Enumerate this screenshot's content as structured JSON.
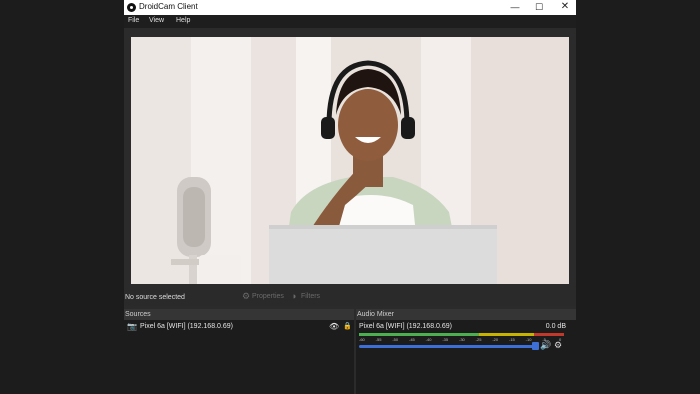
{
  "window": {
    "title": "DroidCam Client"
  },
  "menu": {
    "items": [
      "File",
      "View",
      "Help"
    ]
  },
  "toolbar": {
    "no_source": "No source selected",
    "properties": "Properties",
    "filters": "Filters"
  },
  "sources": {
    "header": "Sources",
    "items": [
      {
        "label": "Pixel 6a [WIFI] (192.168.0.69)"
      }
    ]
  },
  "mixer": {
    "header": "Audio Mixer",
    "channel_name": "Pixel 6a [WIFI] (192.168.0.69)",
    "db_readout": "0.0 dB",
    "scale_labels": [
      "-60",
      "-55",
      "-50",
      "-45",
      "-40",
      "-35",
      "-30",
      "-25",
      "-20",
      "-15",
      "-10",
      "-5",
      "0"
    ],
    "volume_level": 1.0
  },
  "colors": {
    "accent": "#3d6fd6",
    "meter_green": "#4caf50",
    "meter_yellow": "#c8b400",
    "meter_red": "#c0392b"
  }
}
